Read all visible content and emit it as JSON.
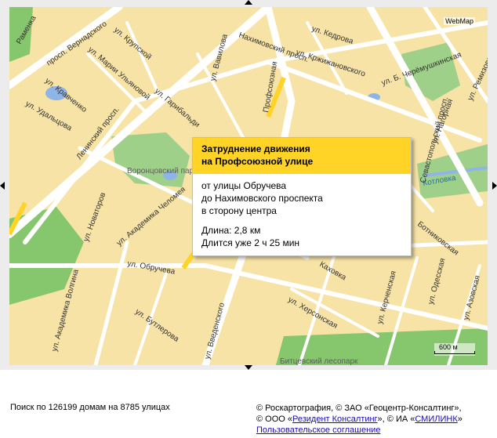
{
  "map": {
    "brand": "WebMap",
    "scale_label": "600 м",
    "streets": [
      "Раменка",
      "просп. Вернадского",
      "ул. Крупской",
      "ул. Марии Ульяновой",
      "ул. Кравченко",
      "ул. Удальцова",
      "Ленинский просп.",
      "ул. Вавилова",
      "ул. Гарибальди",
      "Нахимовский просп.",
      "ул. Кедрова",
      "ул. Кржижановского",
      "ул. Б. Черёмушкинская",
      "ул. Ремизова",
      "ул. Нагорная",
      "Котловка",
      "Профсоюзная",
      "ул. Новаторов",
      "ул. Академика Челомея",
      "ул. Обручева",
      "ул. Академика Волгина",
      "ул. Бутлерова",
      "ул. Херсонская",
      "ул. Введенского",
      "ул. Керченская",
      "ул. Одесская",
      "ул. Азовская",
      "Севастопольский просп.",
      "Ботниковская",
      "Каховка",
      "Битцевский лесопарк",
      "Воронцовский парк"
    ],
    "colors": {
      "land": "#f7e3a6",
      "road": "#ffffff",
      "park": "#86c66d",
      "water": "#8fb5e8",
      "traffic": "#ffd426"
    }
  },
  "popup": {
    "title": "Затруднение движения\nна Профсоюзной улице",
    "lines": [
      "от улицы Обручева",
      "до Нахимовского проспекта",
      "в сторону центра"
    ],
    "length": "Длина: 2,8 км",
    "duration": "Длится уже 2 ч 25 мин"
  },
  "footer": {
    "search_stats": "Поиск по 126199 домам на 8785 улицах",
    "copyright_line1": "© Роскартография, © ЗАО «Геоцентр-Консалтинг»,",
    "copyright_line2_prefix": "© ООО «",
    "copyright_link1": "Резидент Консалтинг",
    "copyright_line2_mid": "», © ИА «",
    "copyright_link2": "СМИЛИНК",
    "copyright_line2_suffix": "»",
    "agreement_link": "Пользовательское соглашение"
  }
}
